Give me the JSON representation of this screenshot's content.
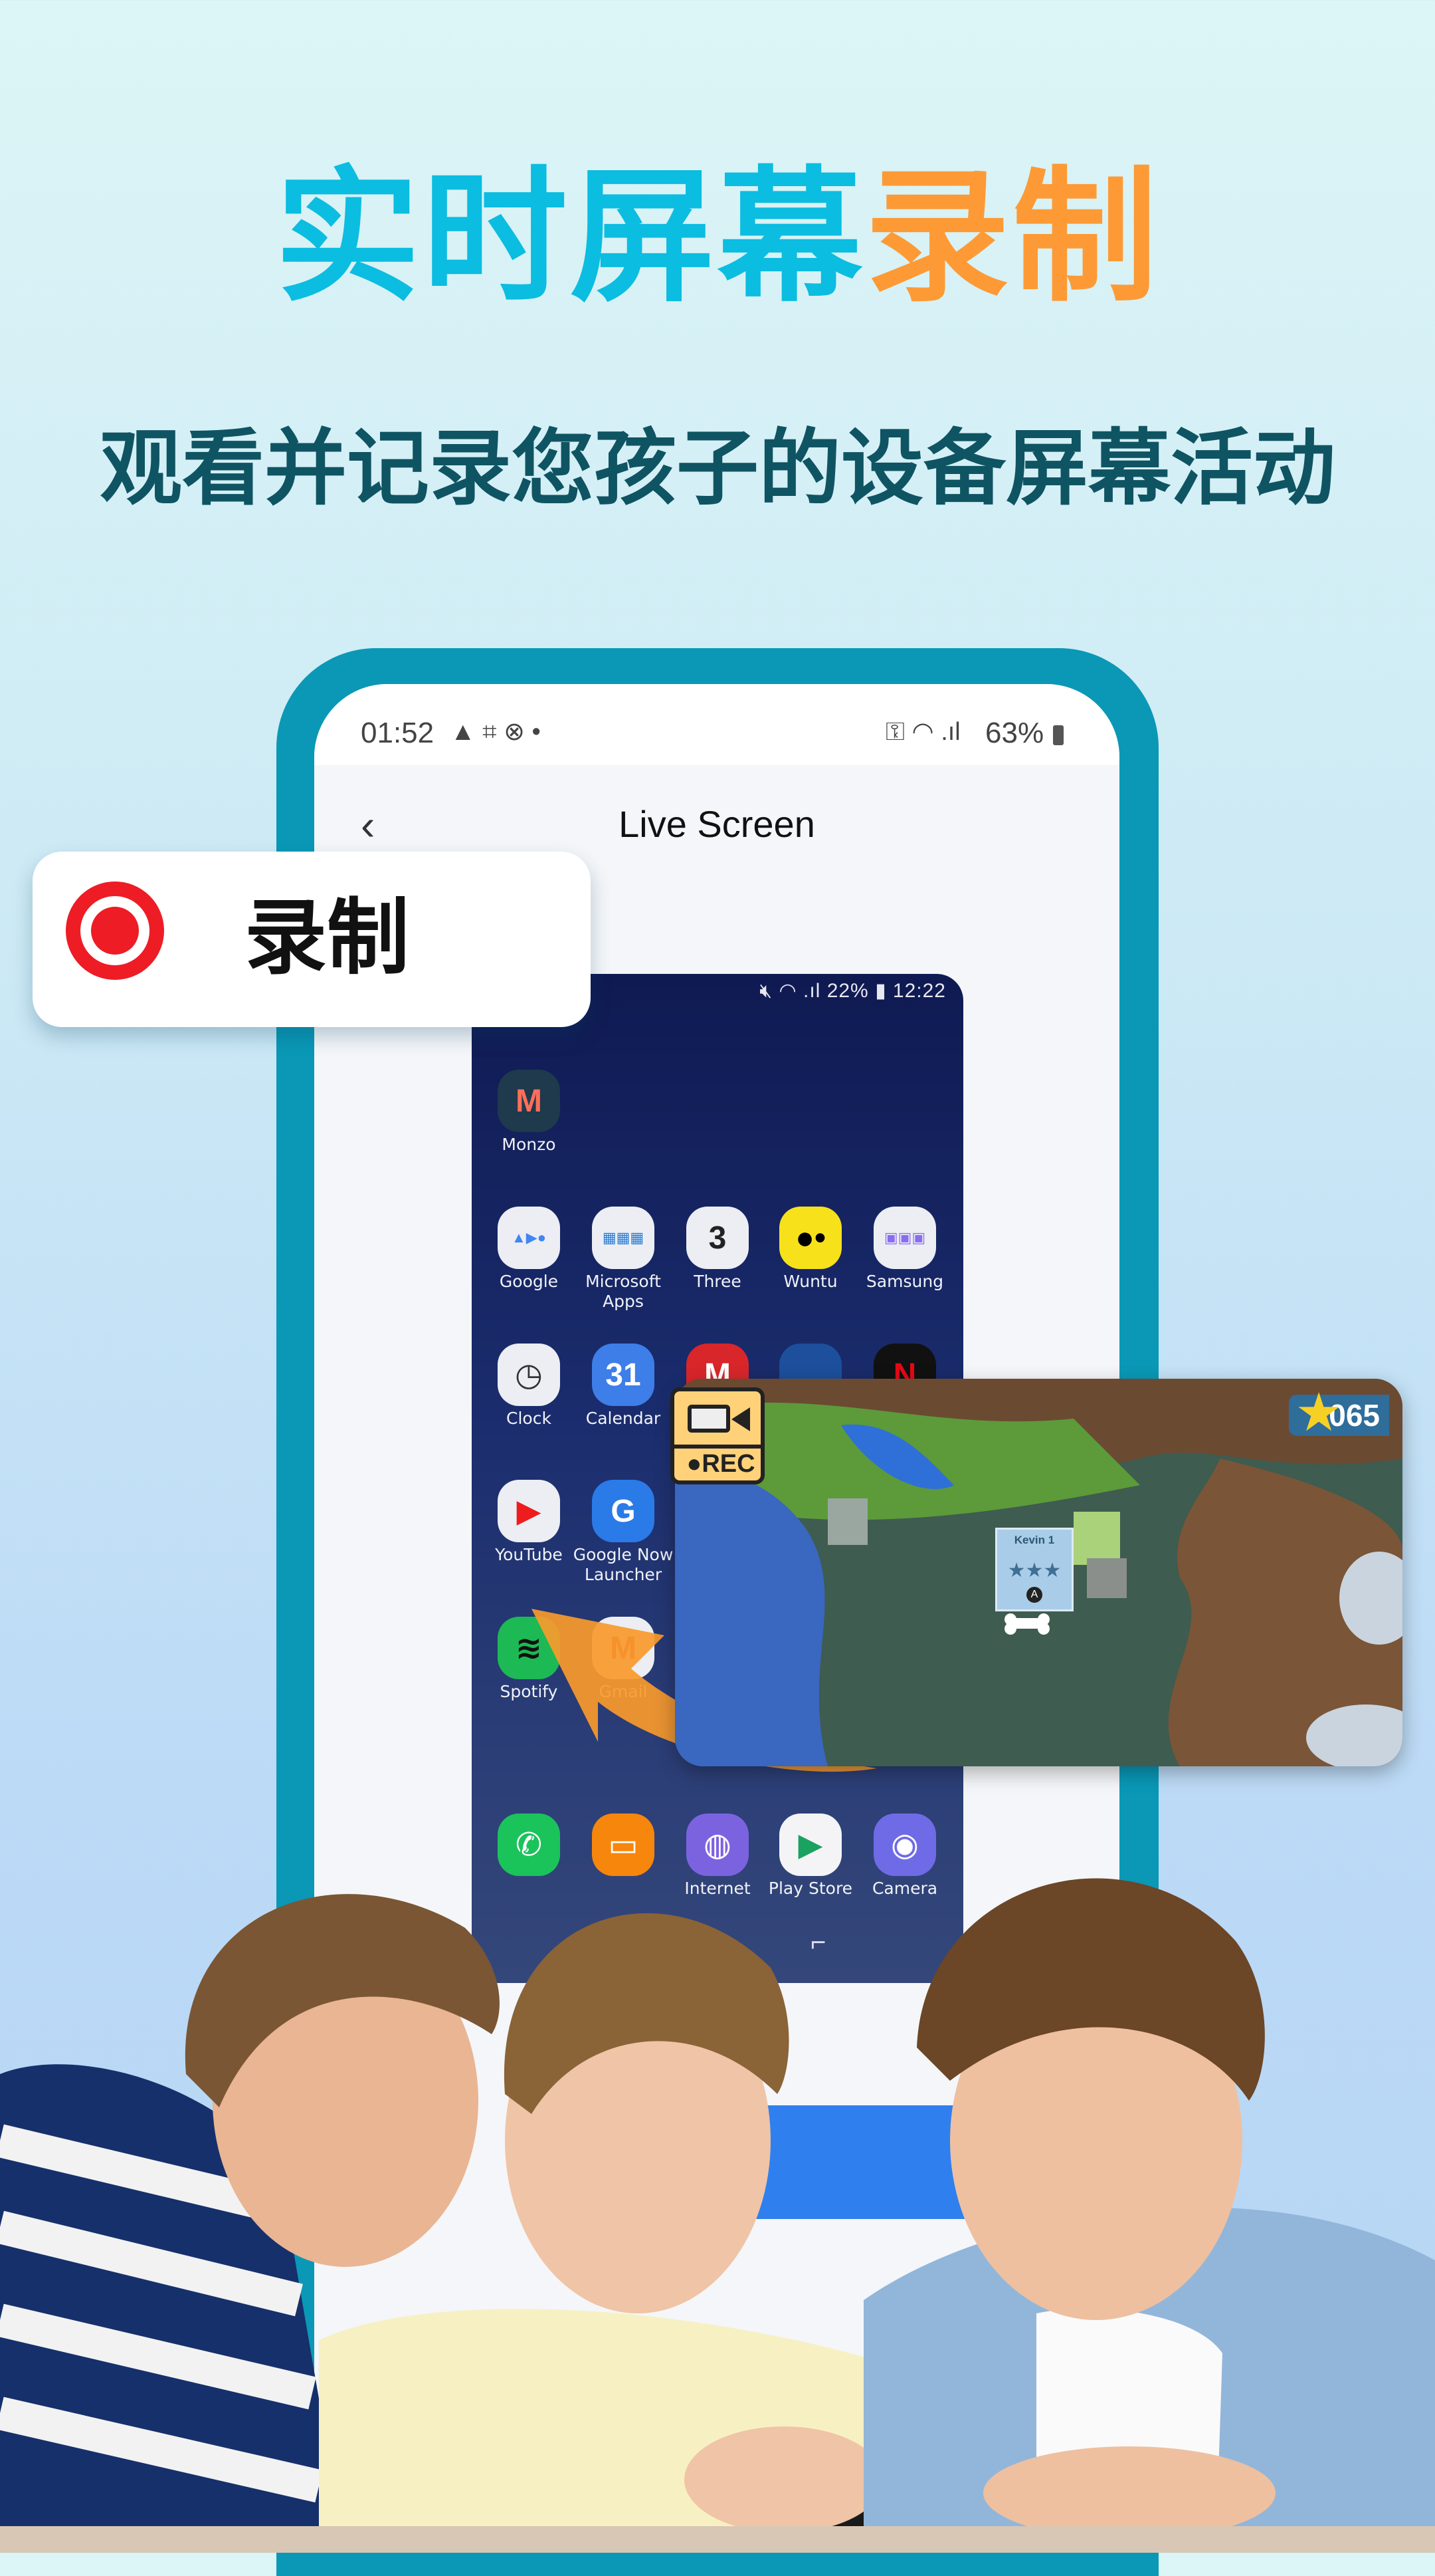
{
  "headline": {
    "part1": "实时屏幕",
    "part2": "录制",
    "color1": "#0bbde0",
    "color2": "#fd9a35"
  },
  "subtitle": "观看并记录您孩子的设备屏幕活动",
  "phone": {
    "status_bar": {
      "time": "01:52",
      "battery": "63%",
      "left_icons": [
        "warning-icon",
        "screenshot-icon",
        "blocked-icon",
        "dot-icon"
      ],
      "right_icons": [
        "vpn-key-icon",
        "wifi-icon",
        "signal-icon",
        "battery-charging-icon"
      ]
    },
    "header": {
      "title": "Live Screen",
      "back_icon": "chevron-left-icon"
    },
    "frame_color": "#0a98b6",
    "button_color": "#2f80ee"
  },
  "record_badge": {
    "label": "录制",
    "icon": "record-icon",
    "color": "#ee1c25"
  },
  "child_screen": {
    "status": {
      "battery": "22%",
      "time": "12:22",
      "icons": [
        "mute-icon",
        "wifi-icon",
        "signal-icon",
        "battery-icon"
      ]
    },
    "apps": [
      {
        "label": "Monzo",
        "icon": "monzo-icon",
        "bg": "#1e3a4c",
        "glyph": "M",
        "fg": "#ff6e5a"
      },
      {
        "label": "Google",
        "icon": "google-folder-icon",
        "bg": "#eceef3",
        "glyph": "▲▶●",
        "fg": "#4285f4"
      },
      {
        "label": "Microsoft Apps",
        "icon": "microsoft-folder-icon",
        "bg": "#eceef3",
        "glyph": "▦▦▦",
        "fg": "#2b7cd3"
      },
      {
        "label": "Three",
        "icon": "three-icon",
        "bg": "#eceef3",
        "glyph": "3",
        "fg": "#222"
      },
      {
        "label": "Wuntu",
        "icon": "wuntu-icon",
        "bg": "#f7e11b",
        "glyph": "●•",
        "fg": "#000"
      },
      {
        "label": "Samsung",
        "icon": "samsung-folder-icon",
        "bg": "#eceef3",
        "glyph": "▣▣▣",
        "fg": "#8a6cf0"
      },
      {
        "label": "Clock",
        "icon": "clock-icon",
        "bg": "#eceef3",
        "glyph": "◷",
        "fg": "#333"
      },
      {
        "label": "Calendar",
        "icon": "calendar-icon",
        "bg": "#3d7ee8",
        "glyph": "31",
        "fg": "#fff"
      },
      {
        "label": "",
        "icon": "mario-icon",
        "bg": "#d8262b",
        "glyph": "M",
        "fg": "#fff"
      },
      {
        "label": "",
        "icon": "blue-app-icon",
        "bg": "#1d4f9c",
        "glyph": "",
        "fg": "#fff"
      },
      {
        "label": "",
        "icon": "netflix-icon",
        "bg": "#111",
        "glyph": "N",
        "fg": "#e50914"
      },
      {
        "label": "YouTube",
        "icon": "youtube-icon",
        "bg": "#eceef3",
        "glyph": "▶",
        "fg": "#ee1c1c"
      },
      {
        "label": "Google Now Launcher",
        "icon": "google-now-icon",
        "bg": "#2a7ae8",
        "glyph": "G",
        "fg": "#fff"
      },
      {
        "label": "Spotify",
        "icon": "spotify-icon",
        "bg": "#1db954",
        "glyph": "≋",
        "fg": "#111"
      },
      {
        "label": "Gmail",
        "icon": "gmail-icon",
        "bg": "#eceef3",
        "glyph": "M",
        "fg": "#d93025"
      },
      {
        "label": "",
        "icon": "phone-icon",
        "bg": "#1bc35b",
        "glyph": "✆",
        "fg": "#fff"
      },
      {
        "label": "",
        "icon": "messages-icon",
        "bg": "#f7860d",
        "glyph": "▭",
        "fg": "#fff"
      },
      {
        "label": "Internet",
        "icon": "internet-icon",
        "bg": "#7b63e0",
        "glyph": "◍",
        "fg": "#fff"
      },
      {
        "label": "Play Store",
        "icon": "play-store-icon",
        "bg": "#f4f4f6",
        "glyph": "▶",
        "fg": "#1aa260"
      },
      {
        "label": "Camera",
        "icon": "camera-icon",
        "bg": "#6f6be6",
        "glyph": "◉",
        "fg": "#fff"
      }
    ]
  },
  "game_overlay": {
    "score": "065",
    "score_icon": "star-icon",
    "level_sign": "Kevin 1",
    "rec_label": "REC",
    "rec_icon": "video-camera-icon",
    "button_glyph": "A"
  }
}
